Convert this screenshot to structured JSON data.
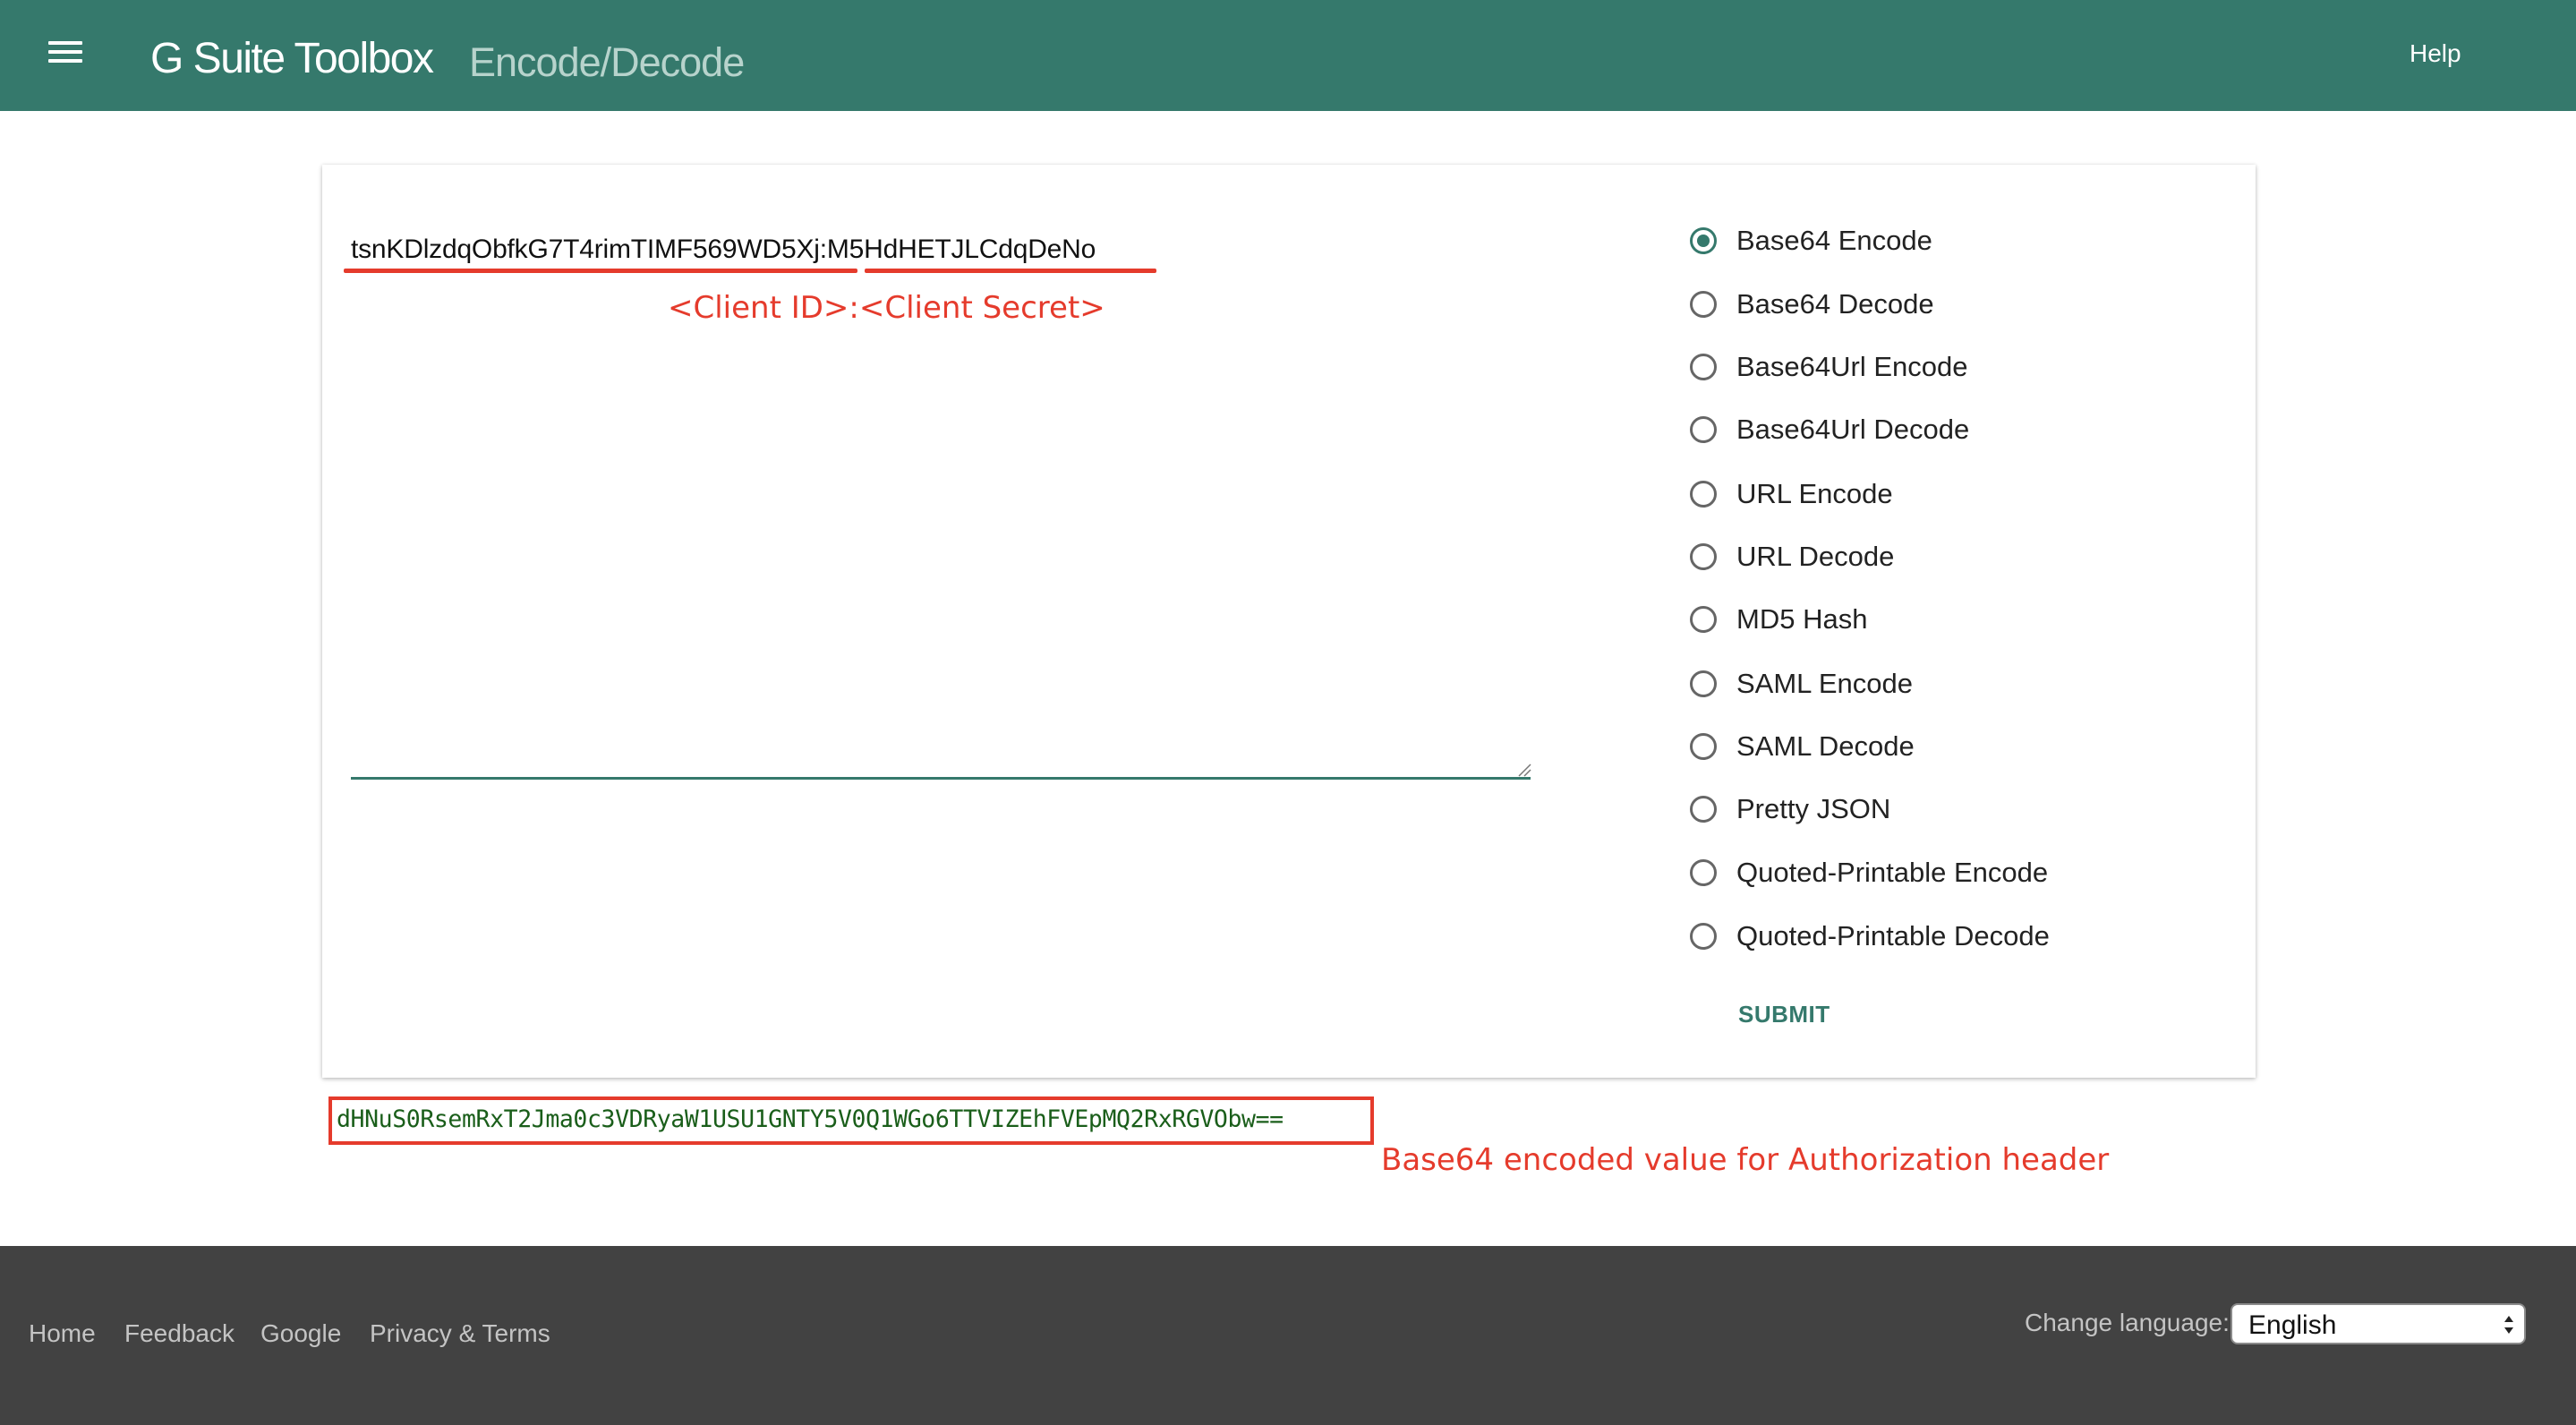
{
  "header": {
    "brand": "G Suite Toolbox",
    "subtitle": "Encode/Decode",
    "help": "Help",
    "menu_icon": "hamburger-menu-icon"
  },
  "form": {
    "input_value": "tsnKDlzdqObfkG7T4rimTIMF569WD5Xj:M5HdHETJLCdqDeNo",
    "input_parts": {
      "client_id": "tsnKDlzdqObfkG7T4rimTIMF569WD5Xj",
      "separator": ":",
      "client_secret": "M5HdHETJLCdqDeNo"
    },
    "options": [
      {
        "label": "Base64 Encode",
        "checked": true
      },
      {
        "label": "Base64 Decode",
        "checked": false
      },
      {
        "label": "Base64Url Encode",
        "checked": false
      },
      {
        "label": "Base64Url Decode",
        "checked": false
      },
      {
        "label": "URL Encode",
        "checked": false
      },
      {
        "label": "URL Decode",
        "checked": false
      },
      {
        "label": "MD5 Hash",
        "checked": false
      },
      {
        "label": "SAML Encode",
        "checked": false
      },
      {
        "label": "SAML Decode",
        "checked": false
      },
      {
        "label": "Pretty JSON",
        "checked": false
      },
      {
        "label": "Quoted-Printable Encode",
        "checked": false
      },
      {
        "label": "Quoted-Printable Decode",
        "checked": false
      }
    ],
    "submit": "SUBMIT"
  },
  "output": {
    "value": "dHNuS0RsemRxT2Jma0c3VDRyaW1USU1GNTY5V0Q1WGo6TTVIZEhFVEpMQ2RxRGVObw=="
  },
  "annotations": {
    "input_note": "<Client ID>:<Client Secret>",
    "output_note": "Base64 encoded value for Authorization header",
    "color": "#e53b2c"
  },
  "footer": {
    "links": [
      "Home",
      "Feedback",
      "Google",
      "Privacy & Terms"
    ],
    "change_language_label": "Change language:",
    "language": "English"
  },
  "colors": {
    "header_bg": "#35796c",
    "footer_bg": "#424242",
    "accent": "#35796c"
  }
}
